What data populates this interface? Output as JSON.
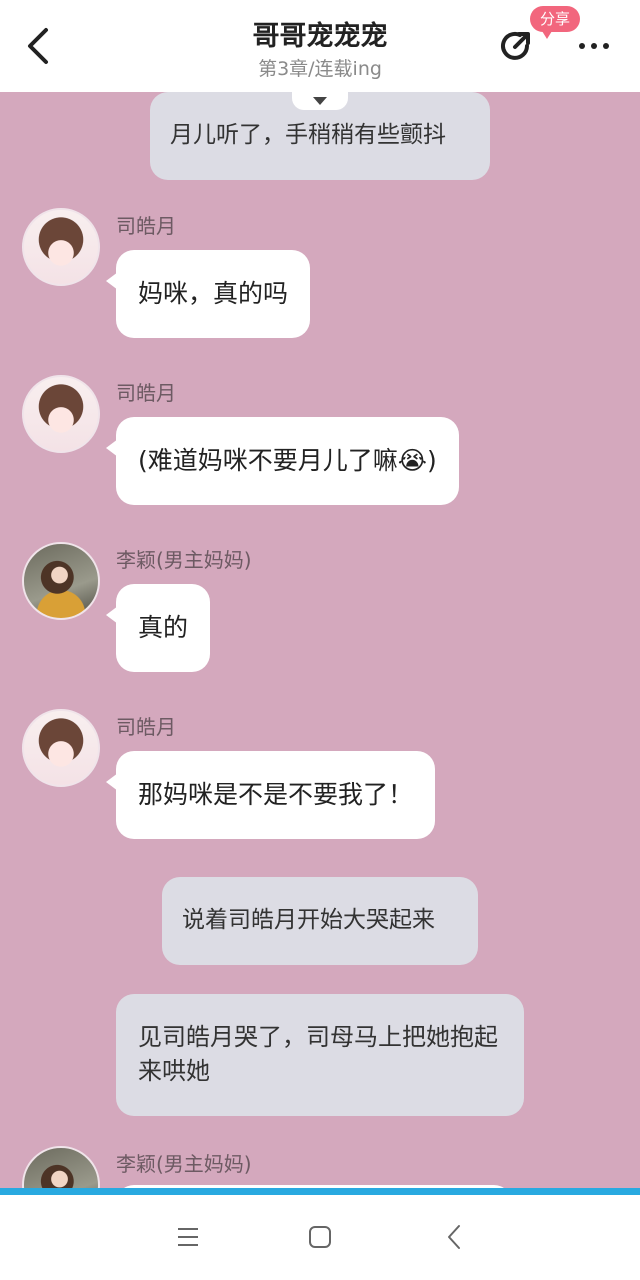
{
  "header": {
    "title": "哥哥宠宠宠",
    "subtitle": "第3章/连载ing",
    "share_badge": "分享"
  },
  "messages": [
    {
      "type": "narration",
      "text": "月儿听了，手稍稍有些颤抖"
    },
    {
      "type": "chat",
      "speaker": "司皓月",
      "avatar": "girl-avatar",
      "text": "妈咪，真的吗"
    },
    {
      "type": "chat",
      "speaker": "司皓月",
      "avatar": "girl-avatar",
      "text": "(难道妈咪不要月儿了嘛😭)"
    },
    {
      "type": "chat",
      "speaker": "李颖(男主妈妈)",
      "avatar": "woman-avatar",
      "text": "真的"
    },
    {
      "type": "chat",
      "speaker": "司皓月",
      "avatar": "girl-avatar",
      "text": "那妈咪是不是不要我了！"
    },
    {
      "type": "narration",
      "text": "说着司皓月开始大哭起来"
    },
    {
      "type": "narration",
      "text": "见司皓月哭了，司母马上把她抱起来哄她"
    },
    {
      "type": "chat",
      "speaker": "李颖(男主妈妈)",
      "avatar": "woman-avatar",
      "text": ""
    }
  ],
  "colors": {
    "chat_background": "#d4a8bd",
    "narration_bubble": "#dcdce4",
    "badge": "#f2667d",
    "progress_strip": "#29a9e0"
  },
  "icons": {
    "back": "back-arrow-icon",
    "share": "share-icon",
    "more": "more-dots-icon",
    "nav_menu": "menu-lines-icon",
    "nav_home": "home-square-icon",
    "nav_back": "nav-back-icon"
  }
}
